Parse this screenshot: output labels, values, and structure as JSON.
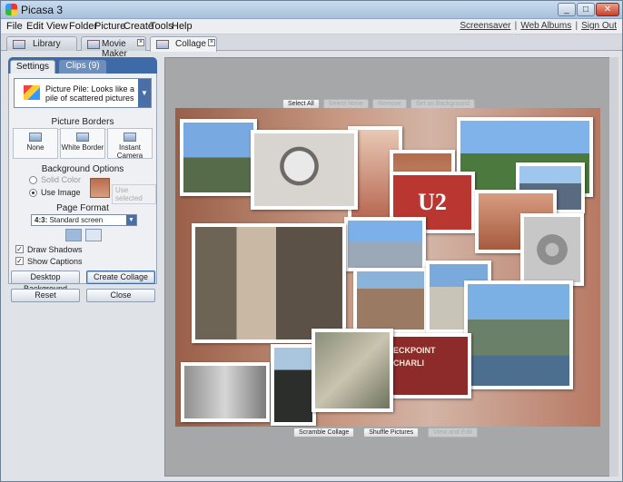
{
  "window": {
    "title": "Picasa 3",
    "controls": [
      "_",
      "□",
      "✕"
    ]
  },
  "menu": {
    "items": [
      "File",
      "Edit",
      "View",
      "Folder",
      "Picture",
      "Create",
      "Tools",
      "Help"
    ],
    "links": [
      "Screensaver",
      "Web Albums",
      "Sign Out"
    ]
  },
  "tabs": [
    {
      "label": "Library"
    },
    {
      "label": "Movie Maker"
    },
    {
      "label": "Collage"
    }
  ],
  "panel": {
    "subtabs": [
      "Settings",
      "Clips (9)"
    ],
    "style": {
      "selected": "Picture Pile:  Looks like a pile of scattered pictures"
    },
    "borders": {
      "heading": "Picture Borders",
      "options": [
        "None",
        "White Border",
        "Instant Camera"
      ]
    },
    "background": {
      "heading": "Background Options",
      "solid": "Solid Color",
      "image": "Use Image",
      "use_selected": "Use selected"
    },
    "format": {
      "heading": "Page Format",
      "ratio": "4:3:",
      "value": "Standard screen"
    },
    "checks": [
      {
        "label": "Draw Shadows",
        "checked": true
      },
      {
        "label": "Show Captions",
        "checked": true
      }
    ],
    "buttons": {
      "desktop": "Desktop Background",
      "create": "Create Collage",
      "reset": "Reset",
      "close": "Close"
    }
  },
  "canvas_controls": {
    "select_all": "Select All",
    "select_none": "Select None",
    "remove": "Remove",
    "set_bg": "Set as Background"
  },
  "canvas_bottom": {
    "scramble": "Scramble Collage",
    "shuffle": "Shuffle Pictures",
    "view_edit": "View and Edit"
  },
  "photo_text": {
    "u2": "U2",
    "checkpoint": "ECKPOINT CHARLI"
  }
}
